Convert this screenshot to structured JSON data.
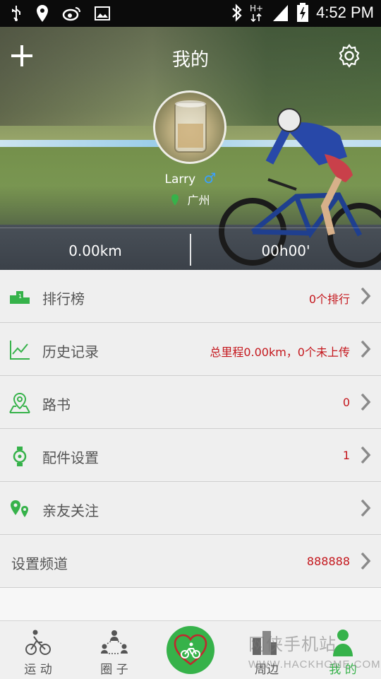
{
  "status_bar": {
    "time": "4:52 PM"
  },
  "header": {
    "title": "我的"
  },
  "profile": {
    "username": "Larry",
    "gender_symbol": "♂",
    "city": "广州"
  },
  "stats": {
    "distance": "0.00km",
    "duration": "00h00'"
  },
  "menu": {
    "items": [
      {
        "label": "排行榜",
        "value": "0个排行"
      },
      {
        "label": "历史记录",
        "value": "总里程0.00km，0个未上传"
      },
      {
        "label": "路书",
        "value": "0"
      },
      {
        "label": "配件设置",
        "value": "1"
      },
      {
        "label": "亲友关注",
        "value": ""
      },
      {
        "label": "设置频道",
        "value": "888888"
      }
    ]
  },
  "bottom_nav": {
    "items": [
      {
        "label": "运 动"
      },
      {
        "label": "圈 子"
      },
      {
        "label": ""
      },
      {
        "label": "周边"
      },
      {
        "label": "我 的"
      }
    ]
  },
  "watermark": {
    "line1": "网侠手机站",
    "line2": "WWW.HACKHOME.COM"
  },
  "colors": {
    "accent_green": "#36b24a",
    "value_red": "#c4161c"
  }
}
